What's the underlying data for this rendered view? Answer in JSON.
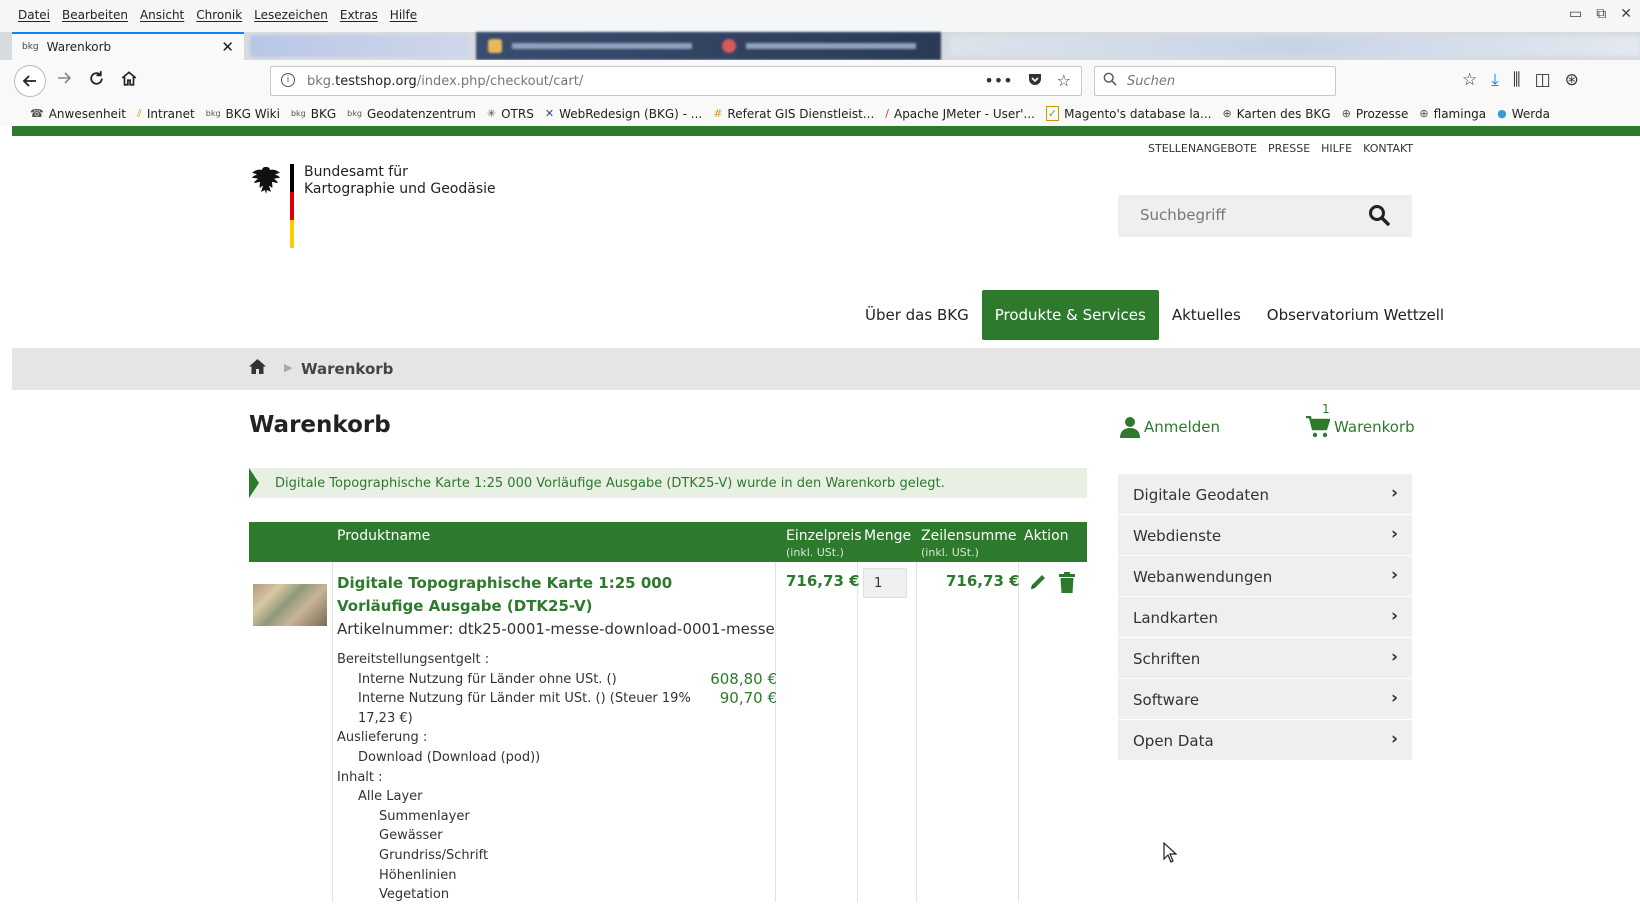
{
  "browser": {
    "menu": [
      "Datei",
      "Bearbeiten",
      "Ansicht",
      "Chronik",
      "Lesezeichen",
      "Extras",
      "Hilfe"
    ],
    "active_tab": {
      "title": "Warenkorb",
      "close": "✕"
    },
    "url_prefix": "bkg.",
    "url_host": "testshop.org",
    "url_path": "/index.php/checkout/cart/",
    "search_placeholder": "Suchen",
    "bookmarks": [
      {
        "icon": "☎",
        "label": "Anwesenheit"
      },
      {
        "icon": "⫽",
        "label": "Intranet"
      },
      {
        "icon": "bkg",
        "label": "BKG Wiki"
      },
      {
        "icon": "bkg",
        "label": "BKG"
      },
      {
        "icon": "bkg",
        "label": "Geodatenzentrum"
      },
      {
        "icon": "✳",
        "label": "OTRS"
      },
      {
        "icon": "✕",
        "label": "WebRedesign (BKG) - ..."
      },
      {
        "icon": "#",
        "label": "Referat GIS Dienstleist..."
      },
      {
        "icon": "/",
        "label": "Apache JMeter - User'..."
      },
      {
        "icon": "✓",
        "label": "Magento's database la..."
      },
      {
        "icon": "⊕",
        "label": "Karten des BKG"
      },
      {
        "icon": "⊕",
        "label": "Prozesse"
      },
      {
        "icon": "⊕",
        "label": "flaminga"
      },
      {
        "icon": "●",
        "label": "Werda"
      }
    ]
  },
  "header": {
    "topnav": [
      "STELLENANGEBOTE",
      "PRESSE",
      "HILFE",
      "KONTAKT"
    ],
    "logo_line1": "Bundesamt für",
    "logo_line2": "Kartographie und Geodäsie",
    "search_placeholder": "Suchbegriff",
    "mainnav": [
      "Über das BKG",
      "Produkte & Services",
      "Aktuelles",
      "Observatorium Wettzell"
    ],
    "flag_colors": [
      "#000000",
      "#dd0000",
      "#ffcc00"
    ],
    "accent": "#2d7a2d"
  },
  "breadcrumb": {
    "current": "Warenkorb"
  },
  "cart": {
    "title": "Warenkorb",
    "login": "Anmelden",
    "cart_label": "Warenkorb",
    "cart_count": "1",
    "notice": "Digitale Topographische Karte 1:25 000 Vorläufige Ausgabe (DTK25-V) wurde in den Warenkorb gelegt.",
    "columns": {
      "product": "Produktname",
      "unit_price": "Einzelpreis",
      "unit_price_sub": "(inkl. USt.)",
      "qty": "Menge",
      "row_total": "Zeilensumme",
      "row_total_sub": "(inkl. USt.)",
      "action": "Aktion"
    },
    "item": {
      "name": "Digitale Topographische Karte 1:25 000 Vorläufige Ausgabe (DTK25-V)",
      "sku": "Artikelnummer: dtk25-0001-messe-download-0001-messe",
      "unit_price": "716,73 €",
      "qty": "1",
      "row_total": "716,73 €",
      "options": {
        "fee_label": "Bereitstellungsentgelt :",
        "fee_internal_no_vat": "Interne Nutzung für Länder ohne USt. ()",
        "fee_internal_no_vat_price": "608,80 €",
        "fee_internal_vat": "Interne Nutzung für Länder mit USt. () (Steuer 19%",
        "fee_internal_vat_2": "17,23 €)",
        "fee_internal_vat_price": "90,70 €",
        "delivery_label": "Auslieferung :",
        "delivery_value": "Download (Download (pod))",
        "content_label": "Inhalt :",
        "content_all": "Alle Layer",
        "layers": [
          "Summenlayer",
          "Gewässer",
          "Grundriss/Schrift",
          "Höhenlinien",
          "Vegetation"
        ]
      }
    }
  },
  "sidebar": {
    "items": [
      "Digitale Geodaten",
      "Webdienste",
      "Webanwendungen",
      "Landkarten",
      "Schriften",
      "Software",
      "Open Data"
    ]
  }
}
